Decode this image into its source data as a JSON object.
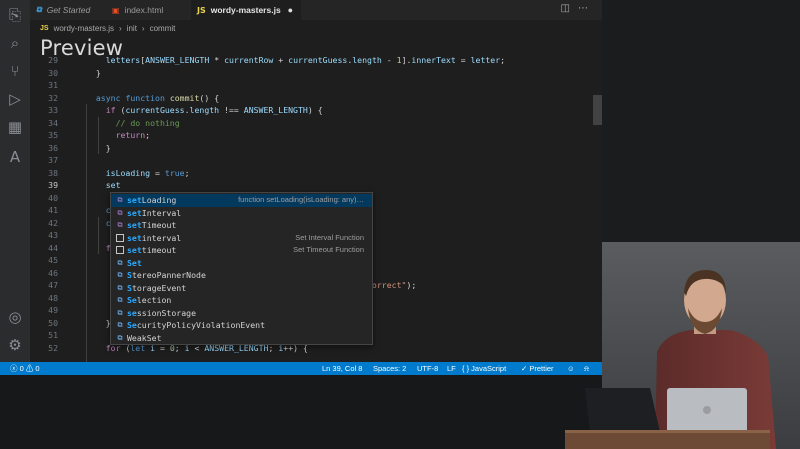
{
  "window": {
    "tabs": [
      {
        "label": "Get Started",
        "icon": "vscode-icon"
      },
      {
        "label": "index.html",
        "icon": "html5-icon"
      },
      {
        "label": "wordy-masters.js",
        "icon": "js-icon",
        "modified": true
      }
    ],
    "breadcrumb": [
      "JS",
      "wordy-masters.js",
      "init",
      "commit"
    ],
    "overlay_label": "Preview"
  },
  "activity_bar": [
    "files-icon",
    "search-icon",
    "source-control-icon",
    "run-debug-icon",
    "extensions-icon",
    "azure-icon",
    "account-icon",
    "settings-gear-icon"
  ],
  "code": [
    {
      "n": "29",
      "html": "    <span class='tk-var'>letters</span>[<span class='tk-var'>ANSWER_LENGTH</span> * <span class='tk-var'>currentRow</span> + <span class='tk-var'>currentGuess</span>.<span class='tk-var'>length</span> - <span class='tk-num'>1</span>].<span class='tk-var'>innerText</span> = <span class='tk-var'>letter</span>;"
    },
    {
      "n": "30",
      "html": "  }"
    },
    {
      "n": "31",
      "html": ""
    },
    {
      "n": "32",
      "html": "  <span class='tk-kw'>async</span> <span class='tk-kw'>function</span> <span class='tk-fn'>commit</span>() {"
    },
    {
      "n": "33",
      "html": "    <span class='tk-kw2'>if</span> (<span class='tk-var'>currentGuess</span>.<span class='tk-var'>length</span> !== <span class='tk-var'>ANSWER_LENGTH</span>) {"
    },
    {
      "n": "34",
      "html": "      <span class='tk-com'>// do nothing</span>"
    },
    {
      "n": "35",
      "html": "      <span class='tk-kw2'>return</span>;"
    },
    {
      "n": "36",
      "html": "    }"
    },
    {
      "n": "37",
      "html": ""
    },
    {
      "n": "38",
      "html": "    <span class='tk-var'>isLoading</span> = <span class='tk-kw'>true</span>;"
    },
    {
      "n": "39",
      "html": "    <span class='tk-var'>set</span>",
      "current": true
    },
    {
      "n": "40",
      "html": ""
    },
    {
      "n": "41",
      "html": "    <span class='tk-kw'>con</span>"
    },
    {
      "n": "42",
      "html": "    <span class='tk-kw'>con</span>"
    },
    {
      "n": "43",
      "html": ""
    },
    {
      "n": "44",
      "html": "    <span class='tk-kw2'>for</span>"
    },
    {
      "n": "45",
      "html": "      /"
    },
    {
      "n": "46",
      "html": "      <span class='tk-kw2'>i</span>"
    },
    {
      "n": "47",
      "html": "                                                 <span class='tk-var'>st</span>.<span class='tk-fn'>add</span>(<span class='tk-str'>\"correct\"</span>);"
    },
    {
      "n": "48",
      "html": ""
    },
    {
      "n": "49",
      "html": "      }"
    },
    {
      "n": "50",
      "html": "    }"
    },
    {
      "n": "51",
      "html": ""
    },
    {
      "n": "52",
      "html": "    <span class='tk-kw2'>for</span> (<span class='tk-kw'>let</span> <span class='tk-var'>i</span> = <span class='tk-num'>0</span>; <span class='tk-var'>i</span> &lt; <span class='tk-var'>ANSWER_LENGTH</span>; <span class='tk-var'>i</span>++) {"
    }
  ],
  "suggestions": [
    {
      "match": "set",
      "rest": "Loading",
      "kind": "function",
      "detail": "function setLoading(isLoading: any)…",
      "selected": true
    },
    {
      "match": "set",
      "rest": "Interval",
      "kind": "function",
      "detail": ""
    },
    {
      "match": "set",
      "rest": "Timeout",
      "kind": "function",
      "detail": ""
    },
    {
      "match": "set",
      "rest": "interval",
      "kind": "snippet",
      "detail": "Set Interval Function"
    },
    {
      "match": "set",
      "rest": "timeout",
      "kind": "snippet",
      "detail": "Set Timeout Function"
    },
    {
      "match": "Set",
      "rest": "",
      "kind": "variable",
      "detail": ""
    },
    {
      "match": "S",
      "rest": "tereoPannerNode",
      "kind": "variable",
      "detail": ""
    },
    {
      "match": "S",
      "rest": "torageEvent",
      "kind": "variable",
      "detail": ""
    },
    {
      "match": "Se",
      "rest": "lection",
      "kind": "variable",
      "detail": ""
    },
    {
      "match": "se",
      "rest": "ssionStorage",
      "kind": "variable",
      "detail": ""
    },
    {
      "match": "Se",
      "rest": "curityPolicyViolationEvent",
      "kind": "variable",
      "detail": ""
    },
    {
      "match": "",
      "rest": "WeakSet",
      "kind": "variable",
      "detail": ""
    }
  ],
  "status": {
    "problems": "ⓧ 0 ⚠ 0",
    "position": "Ln 39, Col 8",
    "spaces": "Spaces: 2",
    "encoding": "UTF-8",
    "eol": "LF",
    "language": "{ } JavaScript",
    "formatter": "✓ Prettier"
  },
  "colors": {
    "accent": "#007acc",
    "editor_bg": "#1e1e1e",
    "selection": "#04395e",
    "match": "#2aaaff"
  }
}
